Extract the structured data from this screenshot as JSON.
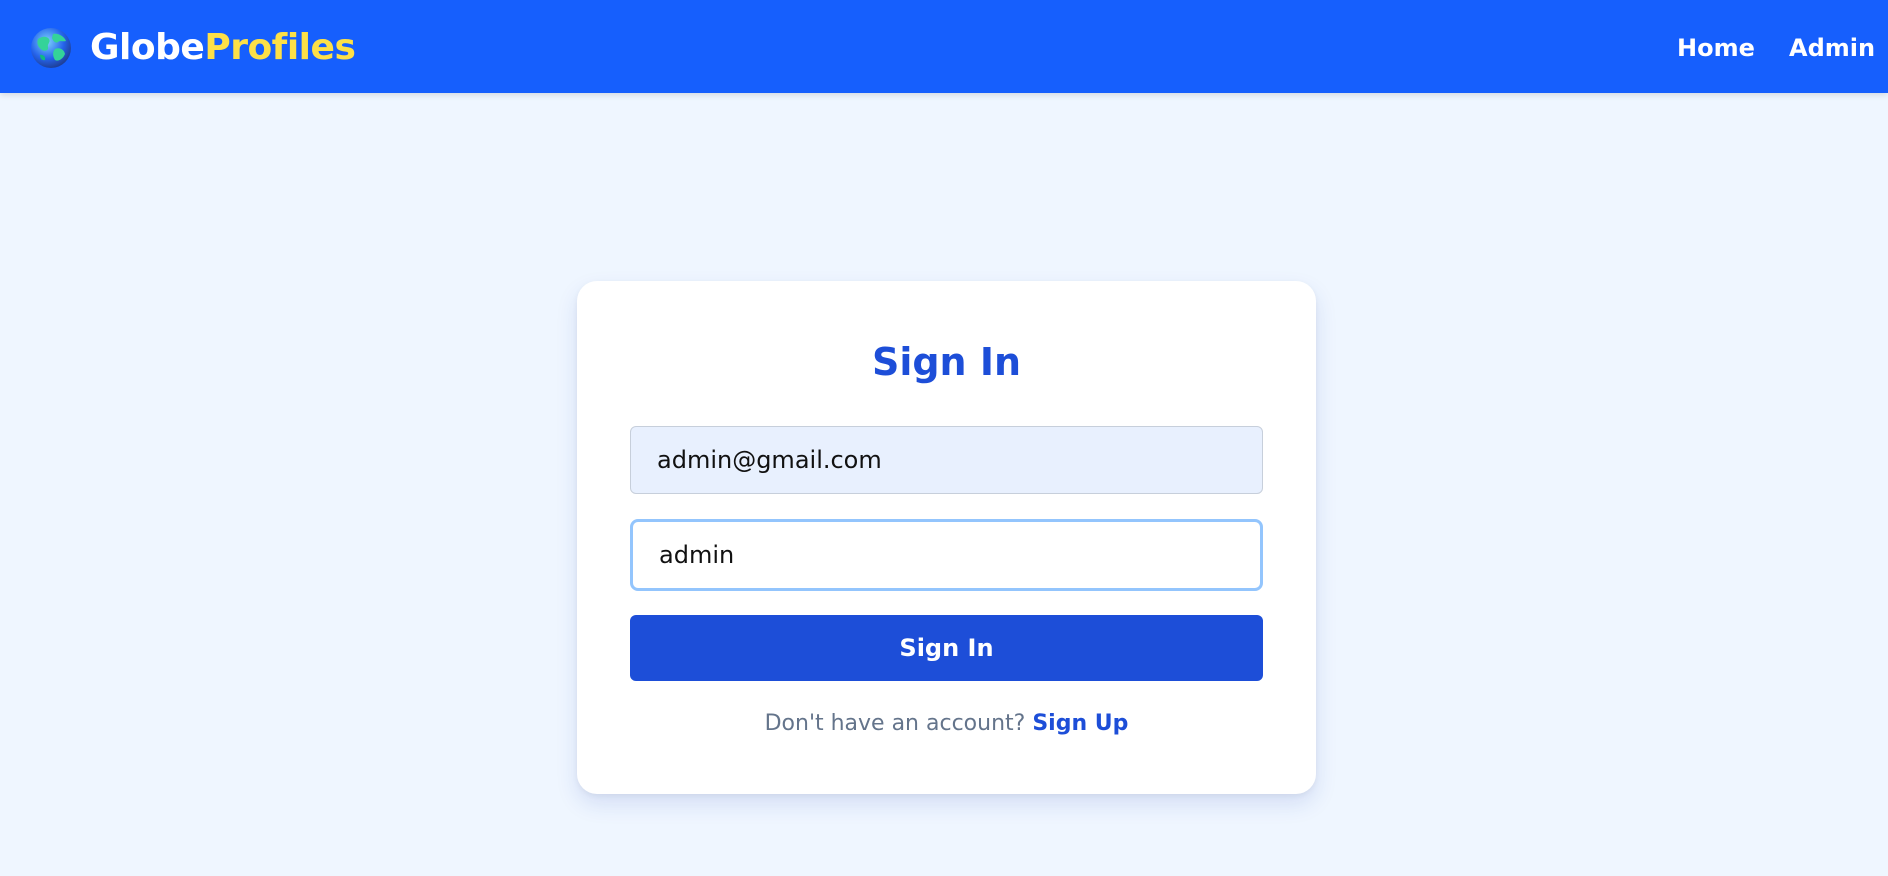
{
  "colors": {
    "navbar": "#165ffd",
    "background": "#eff6ff",
    "accent": "#1d4ed8",
    "brand_highlight": "#fde047",
    "focus_ring": "#93c5fd",
    "autofill": "#e8f0fe"
  },
  "header": {
    "logo_icon": "globe-icon",
    "brand_part1": "Globe",
    "brand_part2": "Profiles",
    "nav": {
      "home": "Home",
      "admin": "Admin"
    }
  },
  "signin": {
    "title": "Sign In",
    "email": {
      "value": "admin@gmail.com"
    },
    "password": {
      "value": "admin"
    },
    "submit_label": "Sign In",
    "footer_text": "Don't have an account?",
    "signup_link": "Sign Up"
  }
}
